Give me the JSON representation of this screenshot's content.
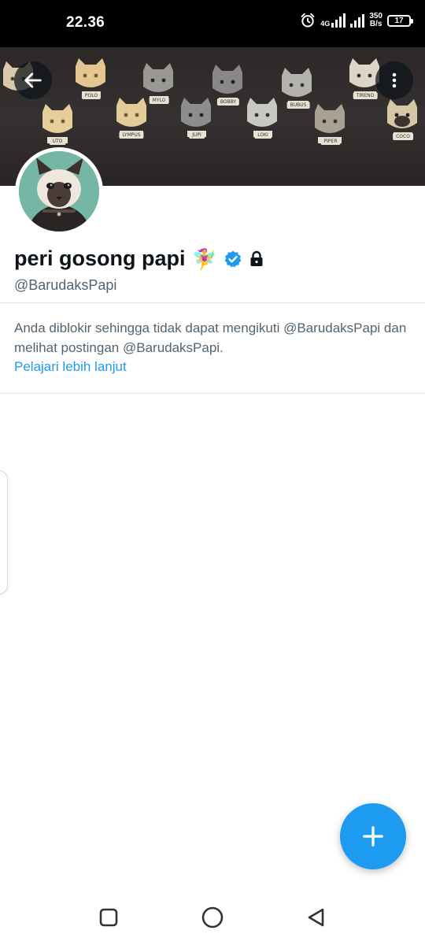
{
  "status_bar": {
    "time": "22.36",
    "network": "4G",
    "speed_top": "350",
    "speed_bottom": "B/s",
    "battery": "17"
  },
  "banner": {
    "cat_tags": [
      "POLO",
      "UTO",
      "LYMPUS",
      "MYLO",
      "JUPI",
      "BOBBY",
      "LOKI",
      "BUBUS",
      "PIPER",
      "TIRENO",
      "COCO"
    ]
  },
  "profile": {
    "display_name": "peri gosong papi",
    "name_emoji": "🧚‍♀️",
    "handle": "@BarudaksPapi",
    "verified": true,
    "protected": true
  },
  "blocked_notice": {
    "message": "Anda diblokir sehingga tidak dapat mengikuti @BarudaksPapi dan melihat postingan @BarudaksPapi.",
    "learn_more": "Pelajari lebih lanjut"
  },
  "icons": {
    "back": "arrow-left-icon",
    "more": "more-vertical-icon",
    "verified": "verified-badge-icon",
    "lock": "lock-icon",
    "compose": "plus-icon",
    "nav_recent": "square-icon",
    "nav_home": "circle-icon",
    "nav_back": "triangle-back-icon"
  },
  "colors": {
    "accent": "#1d9bf0",
    "text_primary": "#0f1419",
    "text_secondary": "#536471",
    "divider": "#dfe3e7"
  }
}
